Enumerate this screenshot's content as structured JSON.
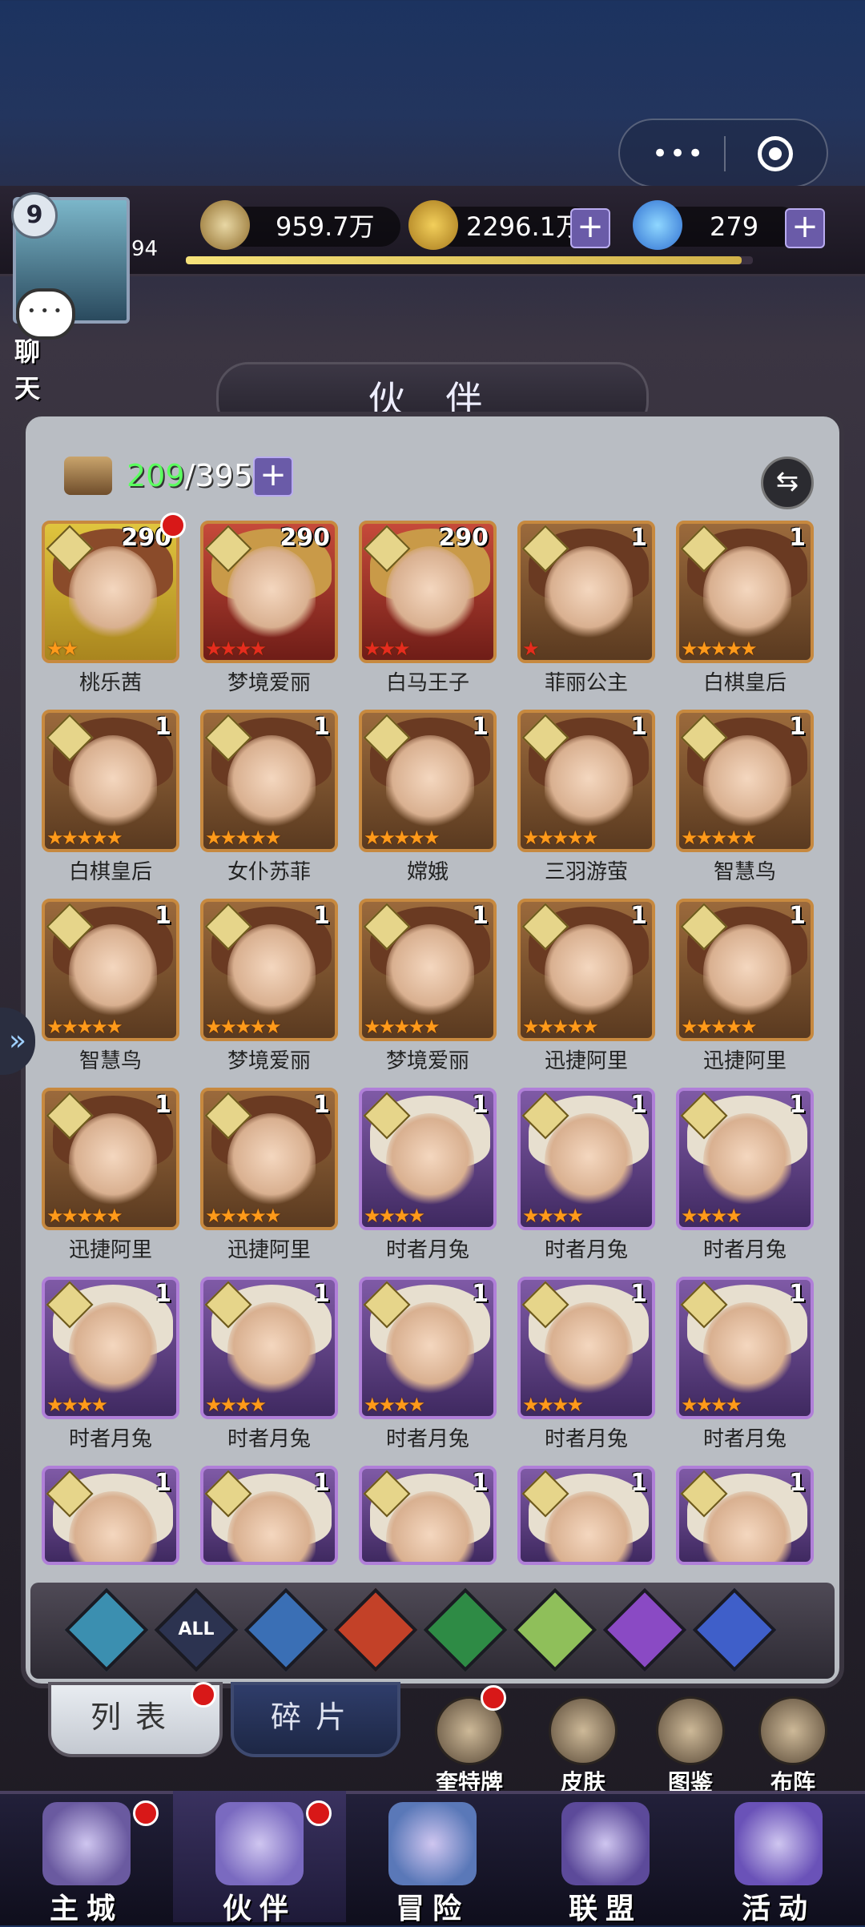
{
  "capsule": {
    "more": "•••"
  },
  "player": {
    "level": "9",
    "exp": "94"
  },
  "chat": {
    "label": "聊 天"
  },
  "resources": {
    "power": "959.7万",
    "gold": "2296.1万",
    "gems": "279",
    "plus": "+"
  },
  "exp_progress": 0.98,
  "title": "伙 伴",
  "roster": {
    "current": "209",
    "max": "/395",
    "plus": "+"
  },
  "colors": {
    "accent_gold": "#c7893f",
    "red_dot": "#d81818",
    "green": "#5cff60"
  },
  "cards": [
    {
      "name": "桃乐茜",
      "level": "290",
      "stars": "★★",
      "rarity": "gold",
      "star_color": "orange",
      "dot": true
    },
    {
      "name": "梦境爱丽",
      "level": "290",
      "stars": "★★★★",
      "rarity": "red",
      "star_color": "red",
      "dot": false
    },
    {
      "name": "白马王子",
      "level": "290",
      "stars": "★★★",
      "rarity": "red",
      "star_color": "red",
      "dot": false
    },
    {
      "name": "菲丽公主",
      "level": "1",
      "stars": "★",
      "rarity": "orange",
      "star_color": "red",
      "dot": false
    },
    {
      "name": "白棋皇后",
      "level": "1",
      "stars": "★★★★★",
      "rarity": "orange",
      "star_color": "orange",
      "dot": false
    },
    {
      "name": "白棋皇后",
      "level": "1",
      "stars": "★★★★★",
      "rarity": "orange",
      "star_color": "orange",
      "dot": false
    },
    {
      "name": "女仆苏菲",
      "level": "1",
      "stars": "★★★★★",
      "rarity": "orange",
      "star_color": "orange",
      "dot": false
    },
    {
      "name": "嫦娥",
      "level": "1",
      "stars": "★★★★★",
      "rarity": "orange",
      "star_color": "orange",
      "dot": false
    },
    {
      "name": "三羽游萤",
      "level": "1",
      "stars": "★★★★★",
      "rarity": "orange",
      "star_color": "orange",
      "dot": false
    },
    {
      "name": "智慧鸟",
      "level": "1",
      "stars": "★★★★★",
      "rarity": "orange",
      "star_color": "orange",
      "dot": false
    },
    {
      "name": "智慧鸟",
      "level": "1",
      "stars": "★★★★★",
      "rarity": "orange",
      "star_color": "orange",
      "dot": false
    },
    {
      "name": "梦境爱丽",
      "level": "1",
      "stars": "★★★★★",
      "rarity": "orange",
      "star_color": "orange",
      "dot": false
    },
    {
      "name": "梦境爱丽",
      "level": "1",
      "stars": "★★★★★",
      "rarity": "orange",
      "star_color": "orange",
      "dot": false
    },
    {
      "name": "迅捷阿里",
      "level": "1",
      "stars": "★★★★★",
      "rarity": "orange",
      "star_color": "orange",
      "dot": false
    },
    {
      "name": "迅捷阿里",
      "level": "1",
      "stars": "★★★★★",
      "rarity": "orange",
      "star_color": "orange",
      "dot": false
    },
    {
      "name": "迅捷阿里",
      "level": "1",
      "stars": "★★★★★",
      "rarity": "orange",
      "star_color": "orange",
      "dot": false
    },
    {
      "name": "迅捷阿里",
      "level": "1",
      "stars": "★★★★★",
      "rarity": "orange",
      "star_color": "orange",
      "dot": false
    },
    {
      "name": "时者月兔",
      "level": "1",
      "stars": "★★★★",
      "rarity": "purple",
      "star_color": "orange",
      "dot": false
    },
    {
      "name": "时者月兔",
      "level": "1",
      "stars": "★★★★",
      "rarity": "purple",
      "star_color": "orange",
      "dot": false
    },
    {
      "name": "时者月兔",
      "level": "1",
      "stars": "★★★★",
      "rarity": "purple",
      "star_color": "orange",
      "dot": false
    },
    {
      "name": "时者月兔",
      "level": "1",
      "stars": "★★★★",
      "rarity": "purple",
      "star_color": "orange",
      "dot": false
    },
    {
      "name": "时者月兔",
      "level": "1",
      "stars": "★★★★",
      "rarity": "purple",
      "star_color": "orange",
      "dot": false
    },
    {
      "name": "时者月兔",
      "level": "1",
      "stars": "★★★★",
      "rarity": "purple",
      "star_color": "orange",
      "dot": false
    },
    {
      "name": "时者月兔",
      "level": "1",
      "stars": "★★★★",
      "rarity": "purple",
      "star_color": "orange",
      "dot": false
    },
    {
      "name": "时者月兔",
      "level": "1",
      "stars": "★★★★",
      "rarity": "purple",
      "star_color": "orange",
      "dot": false
    },
    {
      "name": "",
      "level": "1",
      "stars": "",
      "rarity": "purple",
      "star_color": "orange",
      "dot": false
    },
    {
      "name": "",
      "level": "1",
      "stars": "",
      "rarity": "purple",
      "star_color": "orange",
      "dot": false
    },
    {
      "name": "",
      "level": "1",
      "stars": "",
      "rarity": "purple",
      "star_color": "orange",
      "dot": false
    },
    {
      "name": "",
      "level": "1",
      "stars": "",
      "rarity": "purple",
      "star_color": "orange",
      "dot": false
    },
    {
      "name": "",
      "level": "1",
      "stars": "",
      "rarity": "purple",
      "star_color": "orange",
      "dot": false
    }
  ],
  "filters": [
    {
      "icon": "chevron-element-icon",
      "label": "",
      "color": "#3b8fb0"
    },
    {
      "icon": "all-filter-icon",
      "label": "ALL",
      "color": "#2c3350"
    },
    {
      "icon": "water-element-icon",
      "label": "",
      "color": "#3a6fb5"
    },
    {
      "icon": "fire-element-icon",
      "label": "",
      "color": "#c34128"
    },
    {
      "icon": "wind-element-icon",
      "label": "",
      "color": "#2e8b45"
    },
    {
      "icon": "light-element-icon",
      "label": "",
      "color": "#8fbf5a"
    },
    {
      "icon": "moon-element-icon",
      "label": "",
      "color": "#8a4ac4"
    },
    {
      "icon": "planet-element-icon",
      "label": "",
      "color": "#3f5fc9"
    }
  ],
  "tabs": {
    "list": "列表",
    "fragments": "碎片"
  },
  "side_buttons": [
    {
      "label": "奎特牌",
      "icon": "card-deck-icon",
      "dot": true
    },
    {
      "label": "皮肤",
      "icon": "skin-icon",
      "dot": false
    },
    {
      "label": "图鉴",
      "icon": "codex-icon",
      "dot": false
    },
    {
      "label": "布阵",
      "icon": "formation-icon",
      "dot": false
    }
  ],
  "nav": [
    {
      "label": "主城",
      "icon": "castle-icon",
      "dot": true
    },
    {
      "label": "伙伴",
      "icon": "partner-hat-icon",
      "dot": true
    },
    {
      "label": "冒险",
      "icon": "compass-icon",
      "dot": false
    },
    {
      "label": "联盟",
      "icon": "shield-icon",
      "dot": false
    },
    {
      "label": "活动",
      "icon": "cards-icon",
      "dot": false
    }
  ]
}
